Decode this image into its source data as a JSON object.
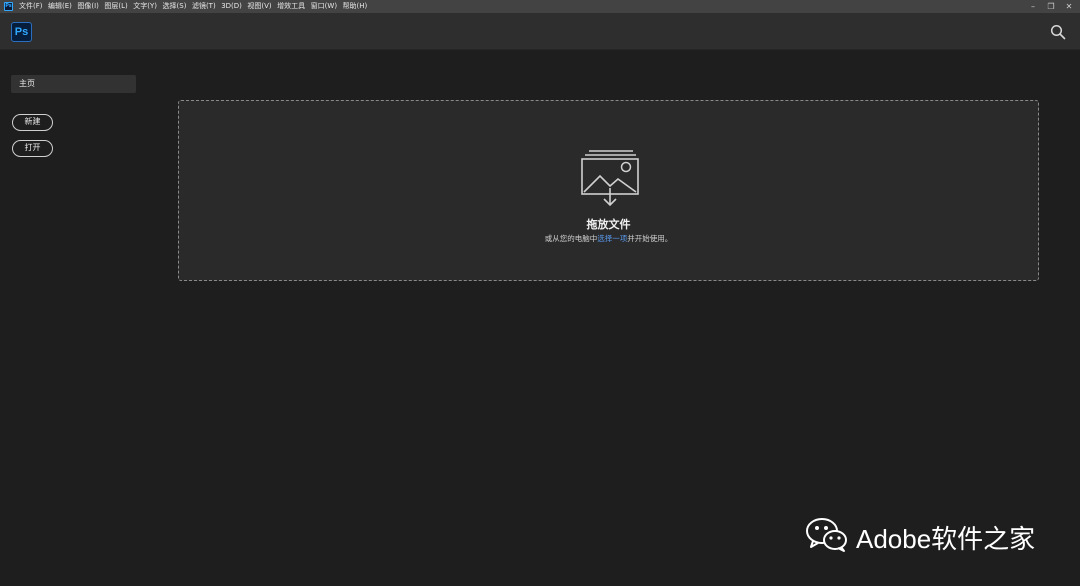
{
  "menubar": {
    "app_icon_text": "Ps",
    "items": [
      "文件(F)",
      "编辑(E)",
      "图像(I)",
      "图层(L)",
      "文字(Y)",
      "选择(S)",
      "滤镜(T)",
      "3D(D)",
      "视图(V)",
      "增效工具",
      "窗口(W)",
      "帮助(H)"
    ],
    "window_controls": {
      "minimize": "–",
      "restore": "❐",
      "close": "✕"
    }
  },
  "header": {
    "logo_text": "Ps",
    "search_icon": "search-icon"
  },
  "sidebar": {
    "home_label": "主页",
    "new_label": "新建",
    "open_label": "打开"
  },
  "dropzone": {
    "icon": "image-import-icon",
    "title": "拖放文件",
    "subtitle_prefix": "或从您的电脑中",
    "subtitle_link": "选择一项",
    "subtitle_suffix": "并开始使用。"
  },
  "watermark": {
    "icon": "wechat-icon",
    "text": "Adobe软件之家"
  },
  "colors": {
    "background": "#1e1e1e",
    "header": "#2e2e2e",
    "ps_blue": "#31a8ff",
    "link": "#5a9bf0"
  }
}
